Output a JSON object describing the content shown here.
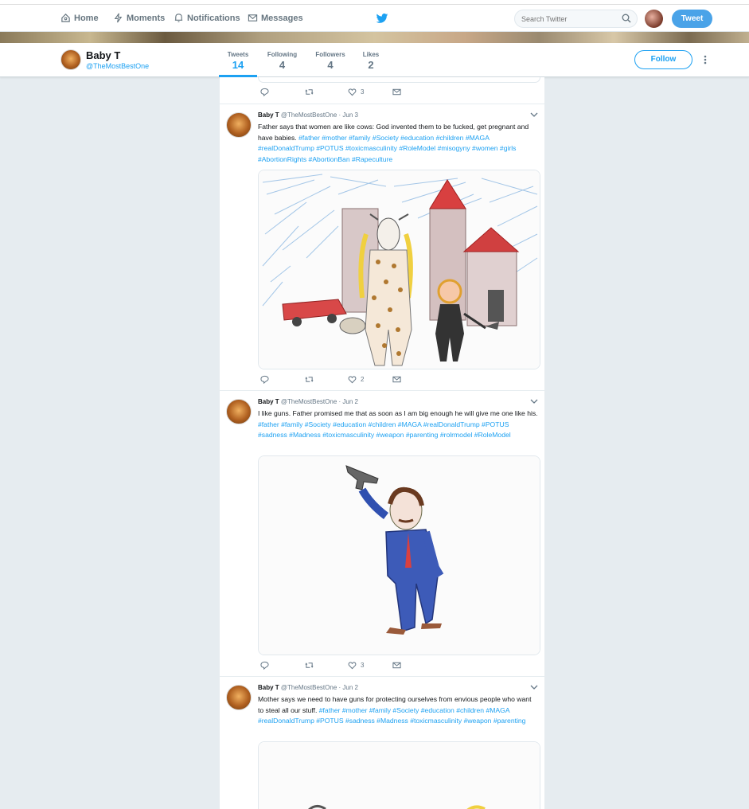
{
  "nav": {
    "home": "Home",
    "moments": "Moments",
    "notifications": "Notifications",
    "messages": "Messages",
    "search_placeholder": "Search Twitter",
    "tweet_button": "Tweet"
  },
  "profile": {
    "name": "Baby T",
    "handle": "@TheMostBestOne",
    "follow_label": "Follow",
    "stats": [
      {
        "label": "Tweets",
        "value": "14"
      },
      {
        "label": "Following",
        "value": "4"
      },
      {
        "label": "Followers",
        "value": "4"
      },
      {
        "label": "Likes",
        "value": "2"
      }
    ]
  },
  "top_actions": {
    "like_count": "3"
  },
  "tweets": [
    {
      "name": "Baby T",
      "handle": "@TheMostBestOne",
      "date": "· Jun 3",
      "text": "Father says that women are like cows: God invented them to be fucked, get pregnant and have babies.",
      "tags": "#father #mother #family #Society #education #children #MAGA #realDonaldTrump #POTUS #toxicmasculinity #RoleModel #misogyny #women #girls #AbortionRights #AbortionBan #Rapeculture",
      "like_count": "2"
    },
    {
      "name": "Baby T",
      "handle": "@TheMostBestOne",
      "date": "· Jun 2",
      "text": "I like guns. Father promised me that as soon as I am big enough he will give me one like his.",
      "tags": "#father #family #Society #education #children #MAGA #realDonaldTrump #POTUS #sadness #Madness #toxicmasculinity #weapon #parenting #rolrmodel #RoleModel",
      "like_count": "3"
    },
    {
      "name": "Baby T",
      "handle": "@TheMostBestOne",
      "date": "· Jun 2",
      "text": "Mother says we need to have guns for protecting ourselves from envious people who want to steal all our stuff.",
      "tags": "#father #mother #family #Society #education #children #MAGA #realDonaldTrump #POTUS #sadness #Madness #toxicmasculinity #weapon #parenting",
      "like_count": ""
    }
  ]
}
